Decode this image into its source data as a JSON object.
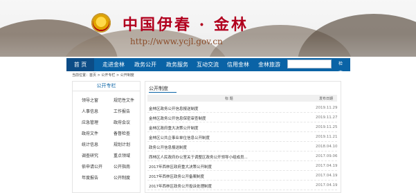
{
  "header": {
    "title": "中国伊春 · 金林",
    "url": "http://www.ycjl.gov.cn",
    "emblem": "national-emblem-icon"
  },
  "nav": {
    "items": [
      "首 页",
      "走进金林",
      "政务公开",
      "政务服务",
      "互动交流",
      "信用金林",
      "金林旅游"
    ],
    "search_placeholder": "",
    "search_button": "检 索"
  },
  "breadcrumb": {
    "prefix": "当前位置：",
    "items": [
      "首页",
      "公开专栏",
      "公开制度"
    ],
    "separator": " > "
  },
  "sidebar": {
    "title": "公开专栏",
    "rows": [
      [
        "领导之窗",
        "规范性文件"
      ],
      [
        "人事信息",
        "工作报告"
      ],
      [
        "应急管理",
        "政府会议"
      ],
      [
        "政府文件",
        "备督检查"
      ],
      [
        "统计信息",
        "规划计划"
      ],
      [
        "调查研究",
        "重点领域"
      ],
      [
        "依申请公开",
        "公开指南"
      ],
      [
        "年度报告",
        "公开制度"
      ],
      [
        "",
        ""
      ]
    ]
  },
  "panel": {
    "title": "公开制度",
    "columns": {
      "title": "标 题",
      "date": "发布日期"
    },
    "rows": [
      {
        "title": "金林区政务公开信息报送制度",
        "date": "2019.11.29"
      },
      {
        "title": "金林区政务公开信息保密审查制度",
        "date": "2019.11.27"
      },
      {
        "title": "金林区政府重大决策公开制度",
        "date": "2019.11.25"
      },
      {
        "title": "金林区公共企事业单位信息公开制度",
        "date": "2019.11.21"
      },
      {
        "title": "政务公开信息报送制度",
        "date": "2018.04.10"
      },
      {
        "title": "西林区人民政府办公室关于调整区政务公开领导小组成员...",
        "date": "2017.09.06"
      },
      {
        "title": "2017年西林区政府重大决策公开制度",
        "date": "2017.04.19"
      },
      {
        "title": "2017年西林区政务公开备案制度",
        "date": "2017.04.19"
      },
      {
        "title": "2017年西林区政务公开投诉处理制度",
        "date": "2017.04.19"
      }
    ]
  },
  "colors": {
    "nav_blue": "#0a63a6",
    "title_red": "#b1001e"
  }
}
